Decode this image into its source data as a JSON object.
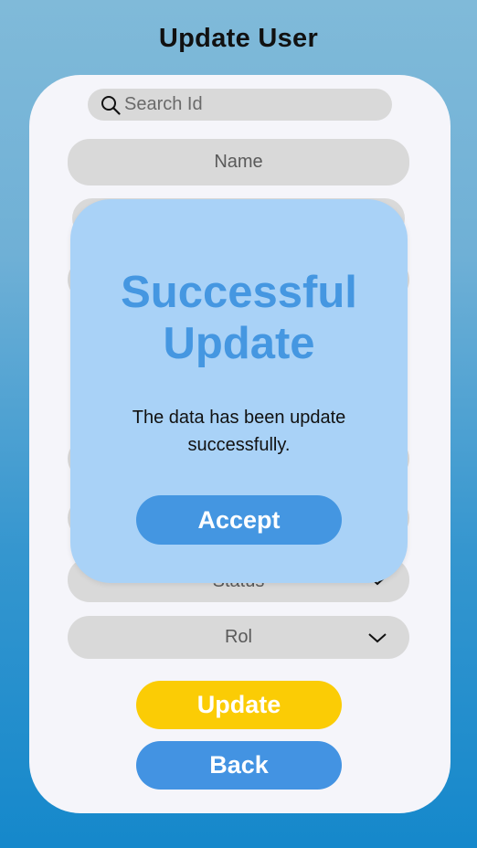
{
  "page": {
    "title": "Update User"
  },
  "search": {
    "placeholder": "Search Id"
  },
  "fields": {
    "name": "Name",
    "status": "Status",
    "rol": "Rol"
  },
  "buttons": {
    "update": "Update",
    "back": "Back"
  },
  "modal": {
    "title_line1": "Successful",
    "title_line2": "Update",
    "message": "The data has been update successfully.",
    "accept": "Accept"
  },
  "colors": {
    "background_top": "#80bad9",
    "background_bottom": "#1588cb",
    "card": "#f5f5fa",
    "field": "#d9d9d9",
    "update_button": "#fbcc05",
    "back_button": "#4393e2",
    "modal": "#a9d2f7",
    "modal_title": "#4597e1",
    "accept_button": "#4496e1"
  },
  "icons": {
    "search": "search-icon",
    "dropdown": "chevron-down-icon"
  }
}
